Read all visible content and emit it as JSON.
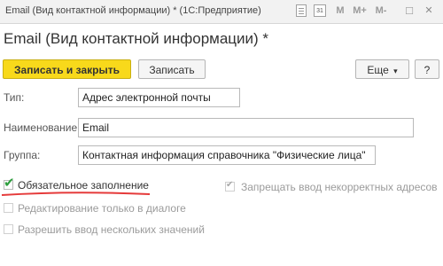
{
  "titlebar": {
    "title": "Email (Вид контактной информации) *",
    "app": "(1С:Предприятие)",
    "calendar_day": "31",
    "m_label": "M",
    "m_plus_label": "M+",
    "m_minus_label": "M-",
    "restore_glyph": "□",
    "close_glyph": "✕"
  },
  "form": {
    "heading": "Email (Вид контактной информации) *",
    "toolbar": {
      "save_close_label": "Записать и закрыть",
      "save_label": "Записать",
      "more_label": "Еще",
      "more_arrow": "▾",
      "help_label": "?"
    },
    "fields": {
      "type_label": "Тип:",
      "type_value": "Адрес электронной почты",
      "name_label": "Наименование:",
      "name_value": "Email",
      "group_label": "Группа:",
      "group_value": "Контактная информация справочника \"Физические лица\""
    },
    "checkboxes": {
      "required_label": "Обязательное заполнение",
      "forbid_incorrect_label": "Запрещать ввод некорректных адресов",
      "dialog_only_label": "Редактирование только в диалоге",
      "allow_multiple_label": "Разрешить ввод нескольких значений",
      "check_mark": "✔"
    }
  }
}
